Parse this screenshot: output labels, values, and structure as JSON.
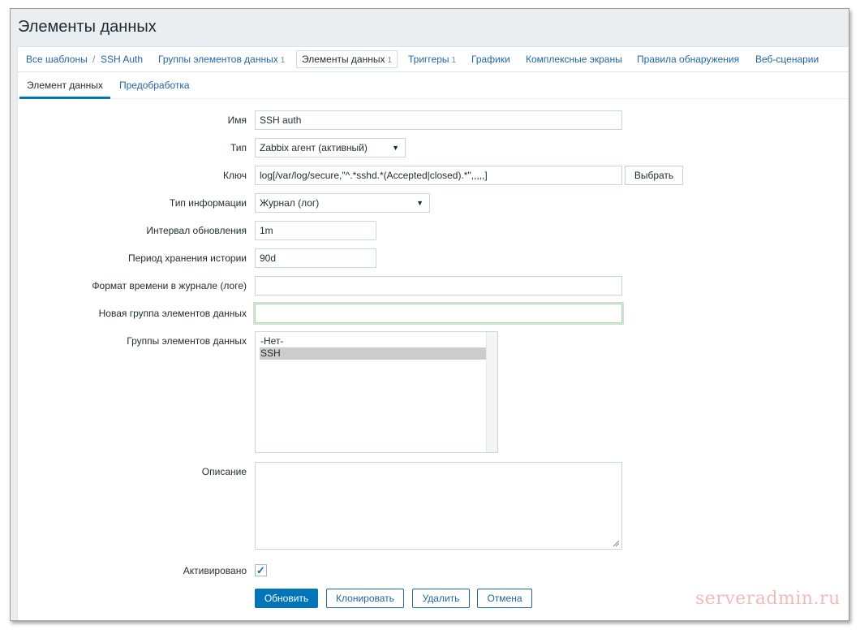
{
  "page_title": "Элементы данных",
  "nav": {
    "breadcrumb_all": "Все шаблоны",
    "breadcrumb_sep": "/",
    "breadcrumb_template": "SSH Auth",
    "items": [
      {
        "label": "Группы элементов данных",
        "count": "1"
      },
      {
        "label": "Элементы данных",
        "count": "1"
      },
      {
        "label": "Триггеры",
        "count": "1"
      },
      {
        "label": "Графики",
        "count": ""
      },
      {
        "label": "Комплексные экраны",
        "count": ""
      },
      {
        "label": "Правила обнаружения",
        "count": ""
      },
      {
        "label": "Веб-сценарии",
        "count": ""
      }
    ]
  },
  "tabs": [
    "Элемент данных",
    "Предобработка"
  ],
  "form": {
    "name": {
      "label": "Имя",
      "value": "SSH auth"
    },
    "type": {
      "label": "Тип",
      "value": "Zabbix агент (активный)"
    },
    "key": {
      "label": "Ключ",
      "value": "log[/var/log/secure,\"^.*sshd.*(Accepted|closed).*\",,,,,]",
      "button": "Выбрать"
    },
    "info_type": {
      "label": "Тип информации",
      "value": "Журнал (лог)"
    },
    "interval": {
      "label": "Интервал обновления",
      "value": "1m"
    },
    "history": {
      "label": "Период хранения истории",
      "value": "90d"
    },
    "log_time_format": {
      "label": "Формат времени в журнале (логе)",
      "value": ""
    },
    "new_app": {
      "label": "Новая группа элементов данных",
      "value": ""
    },
    "apps": {
      "label": "Группы элементов данных",
      "options": [
        "-Нет-",
        "SSH"
      ],
      "selected": "SSH"
    },
    "description": {
      "label": "Описание",
      "value": ""
    },
    "enabled": {
      "label": "Активировано",
      "checked": true
    }
  },
  "buttons": {
    "update": "Обновить",
    "clone": "Клонировать",
    "delete": "Удалить",
    "cancel": "Отмена"
  },
  "watermark": "serveradmin.ru",
  "colors": {
    "link": "#1f65a6",
    "primary": "#0275b8",
    "page_bg": "#ebeef0",
    "text": "#1f2c33"
  },
  "icons": {
    "dropdown": "triangle-down",
    "checkbox": "checkmark",
    "resize": "diagonal-grip"
  }
}
